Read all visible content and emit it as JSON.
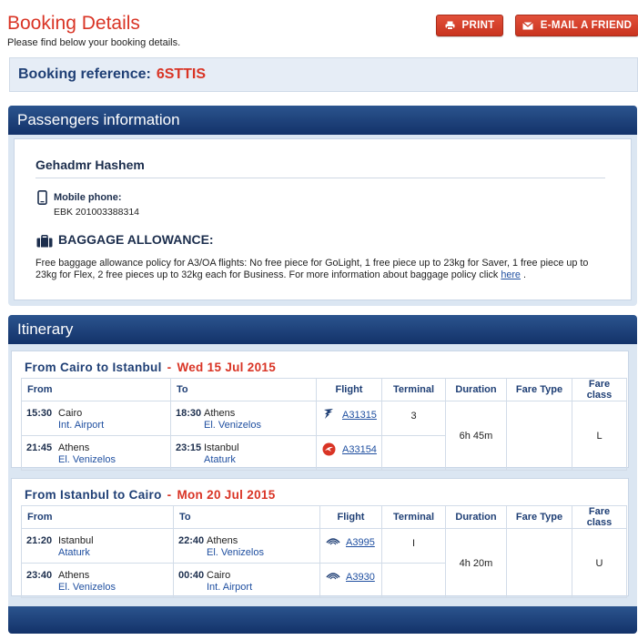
{
  "header": {
    "title": "Booking Details",
    "subtitle": "Please find below your booking details.",
    "print_label": "PRINT",
    "email_label": "E-MAIL A FRIEND"
  },
  "booking": {
    "label": "Booking reference:",
    "code": "6STTIS"
  },
  "passengers": {
    "heading": "Passengers information",
    "name": "Gehadmr Hashem",
    "phone_label": "Mobile phone:",
    "phone_value": "EBK 201003388314",
    "baggage_title": "BAGGAGE ALLOWANCE:",
    "baggage_text": "Free baggage allowance policy for A3/OA flights: No free piece for GoLight, 1 free piece up to 23kg for Saver, 1 free piece up to 23kg for Flex, 2 free pieces up to 32kg each for Business. For more information about baggage policy click ",
    "baggage_link": "here",
    "baggage_end": " ."
  },
  "itinerary": {
    "heading": "Itinerary",
    "columns": {
      "from": "From",
      "to": "To",
      "flight": "Flight",
      "terminal": "Terminal",
      "duration": "Duration",
      "fare_type": "Fare Type",
      "fare_class": "Fare class"
    },
    "segments": [
      {
        "from_word": "From",
        "origin": "Cairo",
        "to_word": "to",
        "destination": "Istanbul",
        "dash": "-",
        "date": "Wed 15 Jul 2015",
        "duration": "6h 45m",
        "fare_type": "",
        "fare_class": "L",
        "legs": [
          {
            "dep_time": "15:30",
            "dep_city": "Cairo",
            "dep_airport": "Int. Airport",
            "arr_time": "18:30",
            "arr_city": "Athens",
            "arr_airport": "El. Venizelos",
            "flight": "A31315",
            "icon": "egyptair-falcon-icon",
            "terminal": "3"
          },
          {
            "dep_time": "21:45",
            "dep_city": "Athens",
            "dep_airport": "El. Venizelos",
            "arr_time": "23:15",
            "arr_city": "Istanbul",
            "arr_airport": "Ataturk",
            "flight": "A33154",
            "icon": "turkish-airlines-icon",
            "terminal": ""
          }
        ]
      },
      {
        "from_word": "From",
        "origin": "Istanbul",
        "to_word": "to",
        "destination": "Cairo",
        "dash": "-",
        "date": "Mon 20 Jul 2015",
        "duration": "4h 20m",
        "fare_type": "",
        "fare_class": "U",
        "legs": [
          {
            "dep_time": "21:20",
            "dep_city": "Istanbul",
            "dep_airport": "Ataturk",
            "arr_time": "22:40",
            "arr_city": "Athens",
            "arr_airport": "El. Venizelos",
            "flight": "A3995",
            "icon": "aegean-icon",
            "terminal": "I"
          },
          {
            "dep_time": "23:40",
            "dep_city": "Athens",
            "dep_airport": "El. Venizelos",
            "arr_time": "00:40",
            "arr_city": "Cairo",
            "arr_airport": "Int. Airport",
            "flight": "A3930",
            "icon": "aegean-icon",
            "terminal": ""
          }
        ]
      }
    ]
  },
  "colors": {
    "accent_red": "#d93425",
    "navy": "#1f3f75",
    "panel_blue": "#dbe6f2"
  }
}
